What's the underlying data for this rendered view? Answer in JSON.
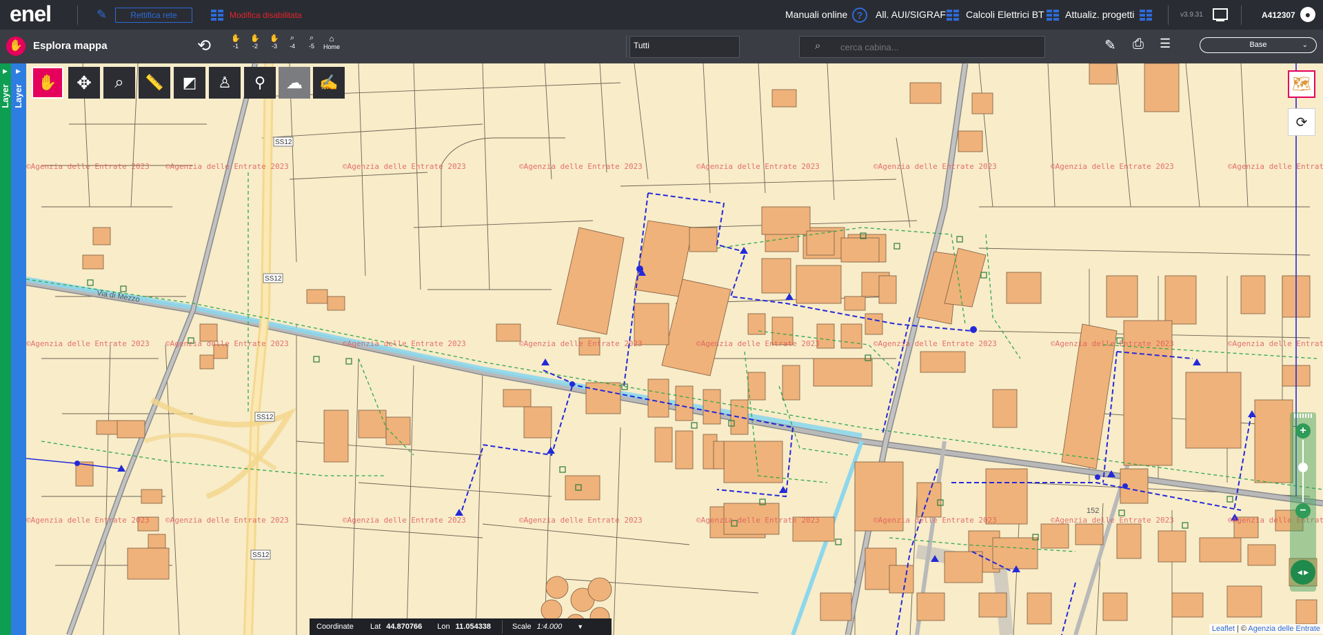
{
  "header": {
    "logo": "enel",
    "rettifica_label": "Rettifica rete",
    "modifica_label": "Modifica disabilitata",
    "links": [
      "Manuali online",
      "All. AUI/SIGRAF",
      "Calcoli Elettrici BT",
      "Attualiz. progetti"
    ],
    "version": "v3.9.31",
    "user": "A412307"
  },
  "toolbar": {
    "title": "Esplora mappa",
    "zoom_buttons": [
      "-1",
      "-2",
      "-3",
      "-4",
      "-5",
      "Home"
    ],
    "filter_value": "Tutti",
    "search_placeholder": "cerca cabina...",
    "base_label": "Base"
  },
  "sidebar": {
    "label_a": "Layer",
    "label_b": "Layer"
  },
  "map": {
    "watermark": "©Agenzia delle Entrate 2023",
    "road_labels": [
      "SS12",
      "SS12",
      "SS12",
      "SS12",
      "Via di Mezzo",
      "152"
    ]
  },
  "coordinates": {
    "label": "Coordinate",
    "lat_label": "Lat",
    "lat": "44.870766",
    "lon_label": "Lon",
    "lon": "11.054338",
    "scale_label": "Scale",
    "scale": "1:4.000"
  },
  "attribution": {
    "leaflet": "Leaflet",
    "sep": "| ©",
    "source": "Agenzia delle Entrate"
  },
  "colors": {
    "accent": "#e5005b",
    "brand_blue": "#2e6bd8",
    "map_bg": "#f8ecc9",
    "building": "#efb27a"
  }
}
